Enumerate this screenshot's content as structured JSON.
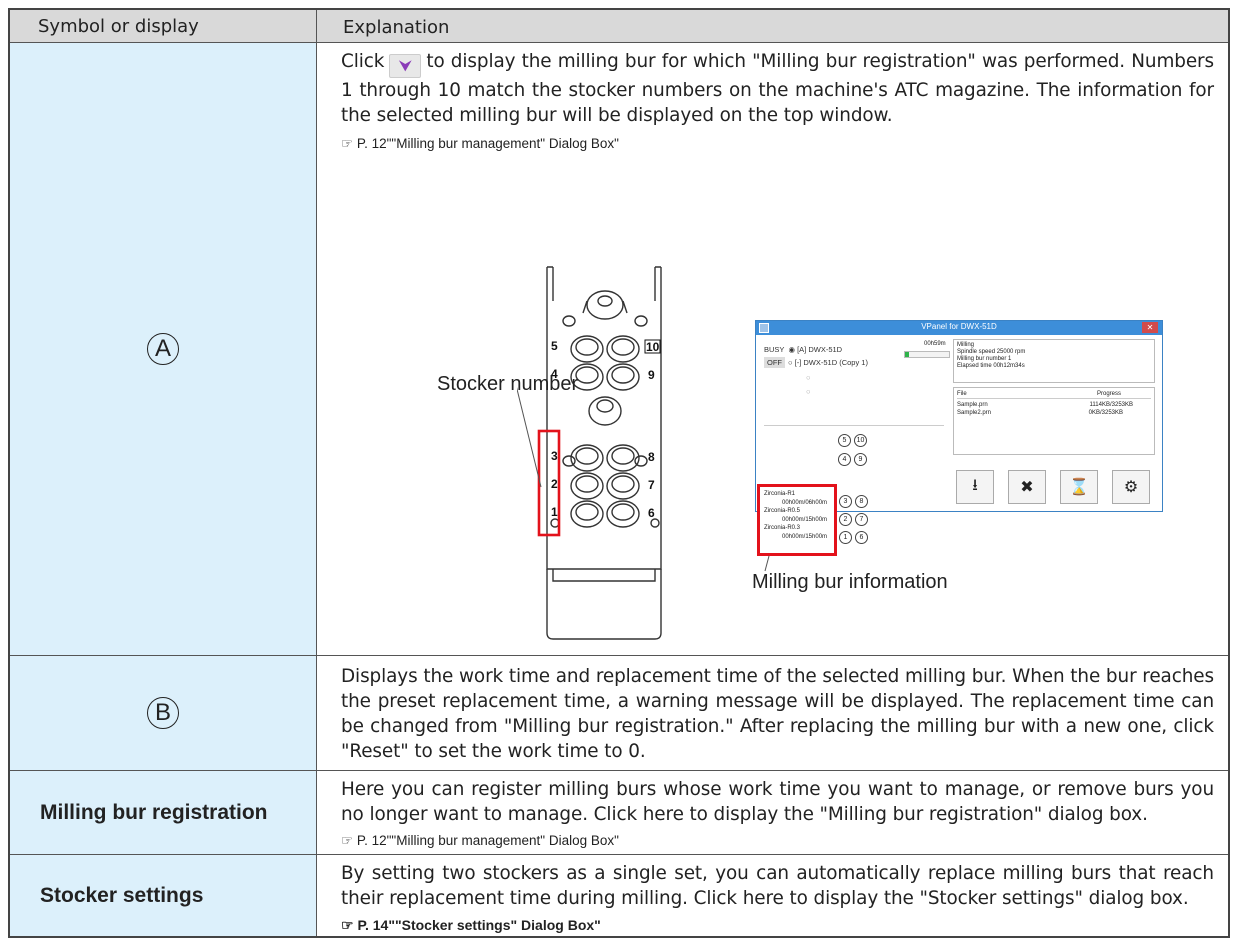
{
  "header": {
    "col1": "Symbol or display",
    "col2": "Explanation"
  },
  "rowA": {
    "symbol": "A",
    "text_before_icon": "Click",
    "text_after_icon": "to display the milling bur for which \"Milling bur registration\" was performed. Numbers 1 through 10 match the stocker numbers on the machine's ATC magazine. The information for the selected milling bur will be displayed on the top window.",
    "reference": "☞ P. 12\"\"Milling bur management\" Dialog Box\"",
    "stocker_caption": "Stocker number",
    "info_caption": "Milling bur information",
    "magazine_numbers_left": [
      "5",
      "4",
      "3",
      "2",
      "1"
    ],
    "magazine_numbers_right": [
      "10",
      "9",
      "8",
      "7",
      "6"
    ],
    "vpanel": {
      "title": "VPanel for DWX-51D",
      "busy_label": "BUSY",
      "off_label": "OFF",
      "machine1": "[A] DWX-51D",
      "machine2": "[-] DWX-51D (Copy 1)",
      "time_remaining": "00h59m",
      "status_lines": [
        "Milling",
        "Spindle speed 25000 rpm",
        "Milling bur number 1",
        "Elapsed time 00h12m34s"
      ],
      "file_header": "File",
      "progress_header": "Progress",
      "files": [
        {
          "name": "Sample.prn",
          "progress": "1114KB/3253KB"
        },
        {
          "name": "Sample2.prn",
          "progress": "0KB/3253KB"
        }
      ],
      "burs": [
        {
          "name": "Zirconia-R1",
          "time": "00h00m/06h00m"
        },
        {
          "name": "Zirconia-R0.5",
          "time": "00h00m/15h00m"
        },
        {
          "name": "Zirconia-R0.3",
          "time": "00h00m/15h00m"
        }
      ],
      "circle_pairs": [
        [
          "5",
          "10"
        ],
        [
          "4",
          "9"
        ],
        [
          "3",
          "8"
        ],
        [
          "2",
          "7"
        ],
        [
          "1",
          "6"
        ]
      ],
      "progress_fraction": 0.1
    }
  },
  "rowB": {
    "symbol": "B",
    "text": "Displays the work time and replacement time of the selected milling bur. When the bur reaches the preset replacement time, a warning message will be displayed. The replacement time can be changed from \"Milling bur registration.\" After replacing the milling bur with a new one, click \"Reset\" to set the work time to 0."
  },
  "rowReg": {
    "symbol": "Milling bur registration",
    "text": "Here you can register milling burs whose work time you want to manage, or remove burs you no longer want to manage. Click here to display the \"Milling bur registration\" dialog box.",
    "reference": "☞ P. 12\"\"Milling bur management\" Dialog Box\""
  },
  "rowStock": {
    "symbol": "Stocker settings",
    "text": "By setting two stockers as a single set, you can automatically replace milling burs that reach their replacement time during milling. Click here to display the \"Stocker settings\" dialog box.",
    "reference": "☞ P. 14\"\"Stocker settings\" Dialog Box\""
  },
  "colors": {
    "symbol_bg": "#dcf0fb",
    "header_bg": "#d9d9d9",
    "highlight_red": "#e3121b",
    "chevron": "#8b3cb8"
  }
}
